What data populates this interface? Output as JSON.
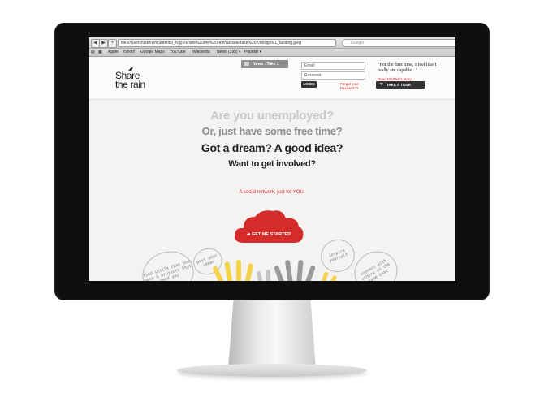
{
  "browser": {
    "url": "file:///Users/user/Documents/_N@k/share%20the%20rain/website/take%202/designs/1_landing.jpeg",
    "search_placeholder": "Google",
    "bookmarks": [
      "Apple",
      "Yahoo!",
      "Google Maps",
      "YouTube",
      "Wikipedia",
      "News (395) ▾",
      "Popular ▾"
    ]
  },
  "site": {
    "logo_line1": "Share",
    "logo_line2": "the rain",
    "news_tab": "News - Take 1",
    "email_placeholder": "Email",
    "password_placeholder": "Password",
    "login_label": "LOGIN",
    "forgot_line1": "Forgot your",
    "forgot_line2": "Password?",
    "quote": "\"For the first time, I feel like I really am capable...\"",
    "read_more": "Read Michael's story...",
    "tour_label": "TAKE A TOUR"
  },
  "hero": {
    "line1": "Are you unemployed?",
    "line2": "Or, just have some free time?",
    "line3": "Got a dream? A good idea?",
    "line4": "Want to get involved?",
    "tagline": "A social network, just for YOU.",
    "cta_label": "GET ME STARTED"
  },
  "bubbles": {
    "b1": "find skills that you need & projects that need you",
    "b2": "post your ideas",
    "b3": "inspire yourself",
    "b4": "connect with others in the same boat"
  },
  "colors": {
    "accent_red": "#d42b2b",
    "dark_button": "#333333",
    "hand_yellow": "#f3d34a",
    "hand_gray": "#9a9a9a"
  }
}
